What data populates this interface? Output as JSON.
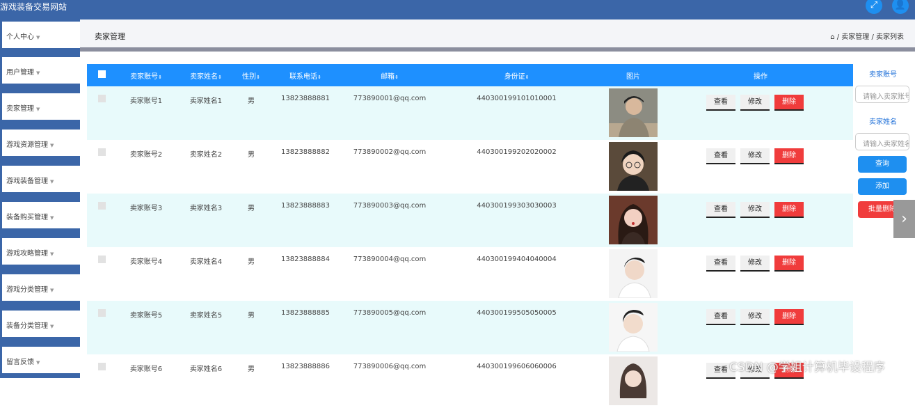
{
  "app": {
    "title": "游戏装备交易网站"
  },
  "top_icons": [
    "fullscreen-icon",
    "user-icon"
  ],
  "sidebar": {
    "items": [
      {
        "label": "个人中心"
      },
      {
        "label": "用户管理"
      },
      {
        "label": "卖家管理"
      },
      {
        "label": "游戏资源管理"
      },
      {
        "label": "游戏装备管理"
      },
      {
        "label": "装备购买管理"
      },
      {
        "label": "游戏攻略管理"
      },
      {
        "label": "游戏分类管理"
      },
      {
        "label": "装备分类管理"
      },
      {
        "label": "留言反馈"
      }
    ]
  },
  "header": {
    "page_title": "卖家管理",
    "breadcrumb": " / 卖家管理 / 卖家列表"
  },
  "table": {
    "columns": [
      "卖家账号",
      "卖家姓名",
      "性别",
      "联系电话",
      "邮箱",
      "身份证",
      "图片",
      "操作"
    ],
    "rows": [
      {
        "account": "卖家账号1",
        "name": "卖家姓名1",
        "gender": "男",
        "phone": "13823888881",
        "email": "773890001@qq.com",
        "idcard": "440300199101010001"
      },
      {
        "account": "卖家账号2",
        "name": "卖家姓名2",
        "gender": "男",
        "phone": "13823888882",
        "email": "773890002@qq.com",
        "idcard": "440300199202020002"
      },
      {
        "account": "卖家账号3",
        "name": "卖家姓名3",
        "gender": "男",
        "phone": "13823888883",
        "email": "773890003@qq.com",
        "idcard": "440300199303030003"
      },
      {
        "account": "卖家账号4",
        "name": "卖家姓名4",
        "gender": "男",
        "phone": "13823888884",
        "email": "773890004@qq.com",
        "idcard": "440300199404040004"
      },
      {
        "account": "卖家账号5",
        "name": "卖家姓名5",
        "gender": "男",
        "phone": "13823888885",
        "email": "773890005@qq.com",
        "idcard": "440300199505050005"
      },
      {
        "account": "卖家账号6",
        "name": "卖家姓名6",
        "gender": "男",
        "phone": "13823888886",
        "email": "773890006@qq.com",
        "idcard": "440300199606060006"
      }
    ],
    "actions": {
      "view": "查看",
      "edit": "修改",
      "delete": "删除"
    }
  },
  "filters": {
    "account_label": "卖家账号",
    "account_placeholder": "请输入卖家账号",
    "name_label": "卖家姓名",
    "name_placeholder": "请输入卖家姓名",
    "search_button": "查询",
    "add_button": "添加",
    "batch_delete_button": "批量删除"
  },
  "watermark": "CSDN @学姐计算机毕设程序",
  "colors": {
    "topbar": "#3b66a8",
    "header_row": "#1e90ff",
    "row_tint": "#e8fafb",
    "primary_button": "#1e8ff0",
    "danger_button": "#f03c3c",
    "filter_label": "#1e6fd8"
  }
}
